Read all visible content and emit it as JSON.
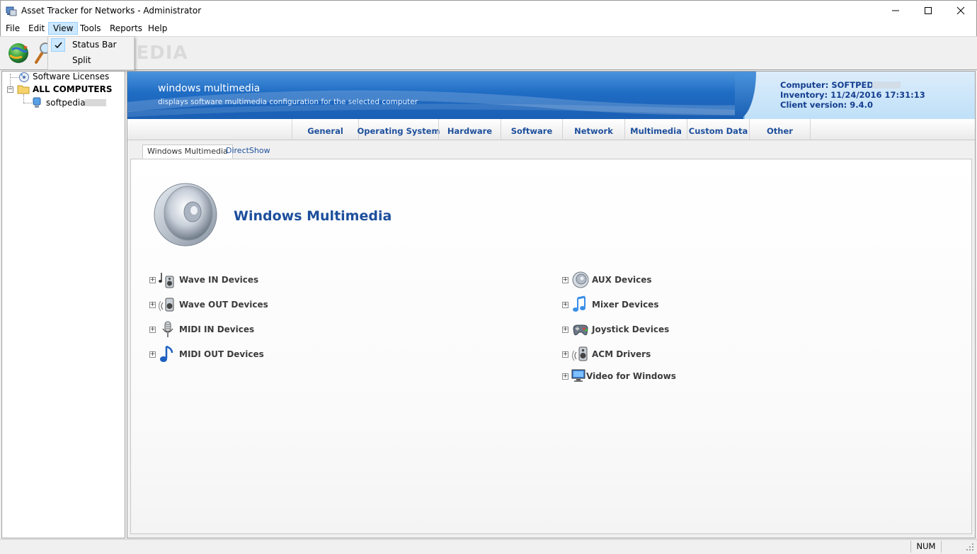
{
  "window": {
    "title": "Asset Tracker for Networks - Administrator",
    "controls": {
      "minimize": "—",
      "maximize": "☐",
      "close": "✕"
    }
  },
  "menu": {
    "items": [
      "File",
      "Edit",
      "View",
      "Tools",
      "Reports",
      "Help"
    ],
    "open_menu": "View",
    "view_dropdown": [
      {
        "label": "Status Bar",
        "checked": true
      },
      {
        "label": "Split",
        "checked": false
      }
    ]
  },
  "toolbar": {
    "watermark": "SOFTPEDIA",
    "buttons": [
      {
        "name": "refresh-globe-icon"
      },
      {
        "name": "search-magnifier-icon"
      }
    ]
  },
  "tree": {
    "software_licenses": "Software Licenses",
    "all_computers": "ALL COMPUTERS",
    "computer": "softpedia-"
  },
  "banner": {
    "title": "windows multimedia",
    "subtitle": "displays software multimedia configuration for the selected computer",
    "computer": "Computer: SOFTPEDIA-",
    "inventory": "Inventory: 11/24/2016 17:31:13",
    "client_version": "Client version: 9.4.0"
  },
  "tabs": [
    "General",
    "Operating System",
    "Hardware",
    "Software",
    "Network",
    "Multimedia",
    "Custom Data",
    "Other"
  ],
  "sub_tabs": [
    "Windows Multimedia",
    "DirectShow"
  ],
  "section": {
    "title": "Windows Multimedia"
  },
  "devices_left": [
    {
      "label": "Wave IN Devices",
      "icon": "wave-in-icon"
    },
    {
      "label": "Wave OUT Devices",
      "icon": "wave-out-icon"
    },
    {
      "label": "MIDI IN Devices",
      "icon": "microphone-icon"
    },
    {
      "label": "MIDI OUT Devices",
      "icon": "music-note-icon"
    }
  ],
  "devices_right": [
    {
      "label": "AUX Devices",
      "icon": "speaker-round-icon"
    },
    {
      "label": "Mixer Devices",
      "icon": "mixer-note-icon"
    },
    {
      "label": "Joystick Devices",
      "icon": "joystick-icon"
    },
    {
      "label": "ACM Drivers",
      "icon": "acm-speaker-icon"
    },
    {
      "label": "Video for Windows",
      "icon": "monitor-icon"
    }
  ],
  "statusbar": {
    "num": "NUM"
  },
  "colors": {
    "accent": "#1d4f9c",
    "banner_blue": "#1f6cc4",
    "banner_info": "#153e8f"
  }
}
